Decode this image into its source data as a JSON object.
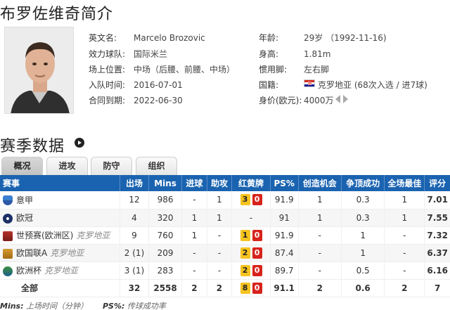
{
  "profile": {
    "title": "布罗佐维奇简介",
    "english_name_label": "英文名:",
    "english_name": "Marcelo Brozovic",
    "club_label": "效力球队:",
    "club": "国际米兰",
    "position_label": "场上位置:",
    "position": "中场（后腰、前腰、中场）",
    "join_label": "入队时间:",
    "join_date": "2016-07-01",
    "contract_label": "合同到期:",
    "contract_date": "2022-06-30",
    "age_label": "年龄:",
    "age": "29岁 （1992-11-16)",
    "height_label": "身高:",
    "height": "1.81m",
    "foot_label": "惯用脚:",
    "foot": "左右脚",
    "nation_label": "国籍:",
    "nation": "克罗地亚 (68次入选 / 进7球)",
    "value_label": "身价(欧元):",
    "value": "4000万"
  },
  "season": {
    "title": "赛季数据",
    "tabs": [
      "概况",
      "进攻",
      "防守",
      "组织"
    ],
    "active_tab": "概况"
  },
  "table": {
    "headers": [
      "赛事",
      "出场",
      "Mins",
      "进球",
      "助攻",
      "红黄牌",
      "PS%",
      "创造机会",
      "争顶成功",
      "全场最佳",
      "评分"
    ],
    "rows": [
      {
        "comp": "意甲",
        "team": "",
        "icon": "serie-a-icon",
        "apps": "12",
        "mins": "986",
        "goals": "-",
        "assists": "1",
        "yellow": "3",
        "red": "0",
        "ps": "91.9",
        "chances": "1",
        "aerials": "0.3",
        "motm": "1",
        "rating": "7.01"
      },
      {
        "comp": "欧冠",
        "team": "",
        "icon": "ucl-icon",
        "apps": "4",
        "mins": "320",
        "goals": "1",
        "assists": "1",
        "yellow": "-",
        "red": "",
        "ps": "91",
        "chances": "1",
        "aerials": "0.3",
        "motm": "1",
        "rating": "7.55"
      },
      {
        "comp": "世预赛(欧洲区)",
        "team": "克罗地亚",
        "icon": "world-cup-icon",
        "apps": "9",
        "mins": "760",
        "goals": "1",
        "assists": "-",
        "yellow": "1",
        "red": "0",
        "ps": "91.9",
        "chances": "-",
        "aerials": "1",
        "motm": "-",
        "rating": "7.32"
      },
      {
        "comp": "欧国联A",
        "team": "克罗地亚",
        "icon": "nations-league-icon",
        "apps": "2 (1)",
        "mins": "209",
        "goals": "-",
        "assists": "-",
        "yellow": "2",
        "red": "0",
        "ps": "87.4",
        "chances": "-",
        "aerials": "1",
        "motm": "-",
        "rating": "6.37"
      },
      {
        "comp": "欧洲杯",
        "team": "克罗地亚",
        "icon": "euro-icon",
        "apps": "3 (1)",
        "mins": "283",
        "goals": "-",
        "assists": "-",
        "yellow": "2",
        "red": "0",
        "ps": "89.7",
        "chances": "-",
        "aerials": "0.5",
        "motm": "-",
        "rating": "6.16"
      }
    ],
    "total": {
      "label": "全部",
      "apps": "32",
      "mins": "2558",
      "goals": "2",
      "assists": "2",
      "yellow": "8",
      "red": "0",
      "ps": "91.1",
      "chances": "2",
      "aerials": "0.6",
      "motm": "2",
      "rating": "7"
    }
  },
  "footnote": {
    "mins_label": "Mins:",
    "mins_text": "上场时间（分钟）",
    "ps_label": "PS%:",
    "ps_text": "传球成功率"
  },
  "colors": {
    "header_blue": "#1a63b0",
    "yellow_card": "#f6c31f",
    "red_card": "#d7231c",
    "rating": "#e05a10"
  }
}
